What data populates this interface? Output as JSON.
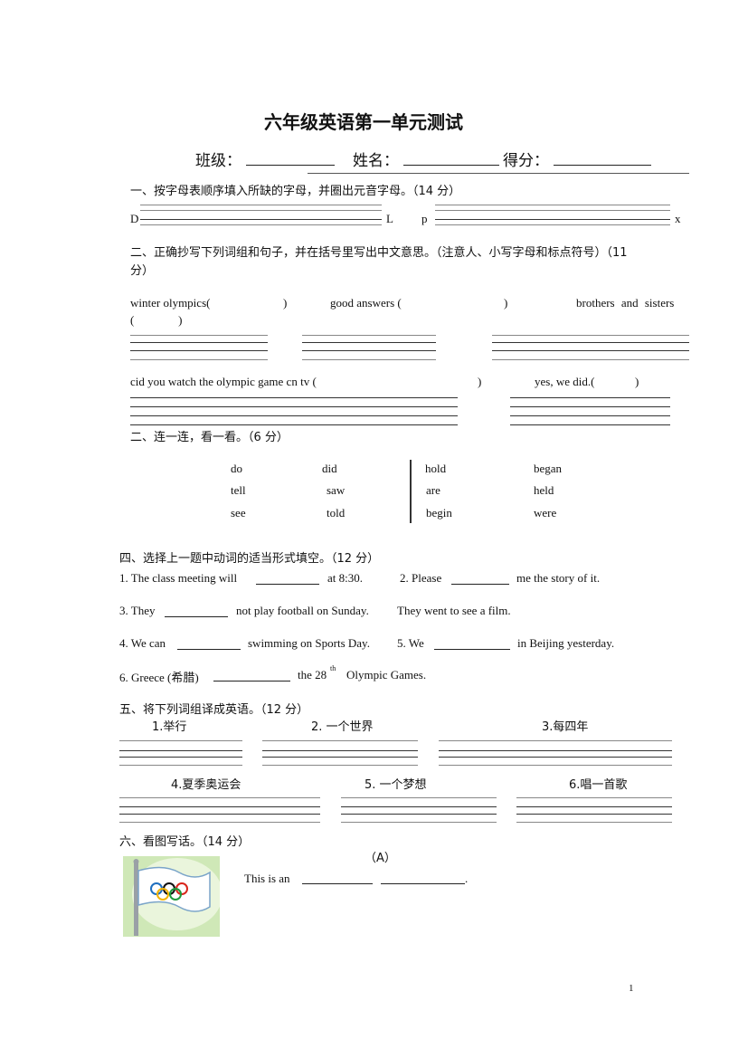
{
  "title": "六年级英语第一单元测试",
  "header": {
    "class_label": "班级：",
    "name_label": "姓名：",
    "score_label": "得分："
  },
  "s1": {
    "heading": "一、按字母表顺序填入所缺的字母，并圈出元音字母。（14 分）",
    "start_left": "D",
    "end_left": "L",
    "start_right": "p",
    "end_right": "x"
  },
  "s2": {
    "heading_line1": "二、正确抄写下列词组和句子，并在括号里写出中文意思。（注意人、小写字母和标点符号）（11",
    "heading_line2": "分）",
    "item1": "winter  olympics(",
    "item1_close": ")",
    "item2": "good  answers  (",
    "item2_close": ")",
    "item3": "brothers  and  sisters",
    "item3_paren": "(               )",
    "item4": "cid you watch the olympic game cn tv (",
    "item4_close": ")",
    "item5": "yes, we did.(",
    "item5_close": ")"
  },
  "s3": {
    "heading": "二、连一连，看一看。（6 分）",
    "col1": [
      "do",
      "tell",
      "see"
    ],
    "col2": [
      "did",
      "saw",
      "told"
    ],
    "col3": [
      "hold",
      "are",
      "begin"
    ],
    "col4": [
      "began",
      "held",
      "were"
    ]
  },
  "s4": {
    "heading": "四、选择上一题中动词的适当形式填空。（12 分）",
    "q1a": "1. The class meeting will",
    "q1b": "at 8:30.",
    "q2a": "2. Please",
    "q2b": "me the story of it.",
    "q3a": "3. They",
    "q3b": "not play football on Sunday.",
    "q3c": "They went to see a film.",
    "q4a": "4. We can",
    "q4b": "swimming on Sports Day.",
    "q5a": "5. We",
    "q5b": "in Beijing yesterday.",
    "q6a": "6. Greece (希腊)",
    "q6b": "the 28",
    "q6sup": "th",
    "q6c": "Olympic Games."
  },
  "s5": {
    "heading": "五、将下列词组译成英语。（12 分）",
    "items": [
      "1.举行",
      "2. 一个世界",
      "3.每四年",
      "4.夏季奥运会",
      "5. 一个梦想",
      "6.唱一首歌"
    ]
  },
  "s6": {
    "heading": "六、看图写话。（14 分）",
    "sub": "（A）",
    "sentence": "This is an",
    "end": "."
  },
  "page_number": "1",
  "image": {
    "icon": "olympic-flag-icon",
    "colors": [
      "#1f6fbf",
      "#111111",
      "#d9261c",
      "#f2b300",
      "#1e9a3c"
    ]
  }
}
